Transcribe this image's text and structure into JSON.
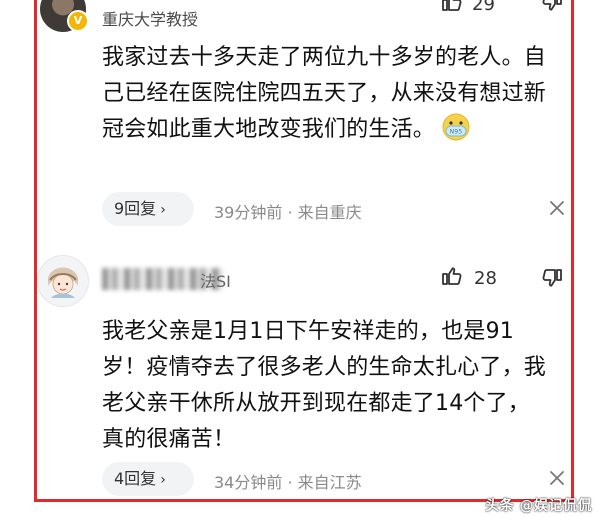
{
  "comments": [
    {
      "author": "重庆大学教授",
      "verified_badge": "V",
      "likes": "29",
      "text": "我家过去十多天走了两位九十多岁的老人。自己已经在医院住院四五天了，从来没有想过新冠会如此重大地改变我们的生活。",
      "emoji_label": "N95",
      "replies": "9回复",
      "time": "39分钟前 · 来自重庆"
    },
    {
      "author_tail": "法SI",
      "likes": "28",
      "text": "我老父亲是1月1日下午安祥走的，也是91岁！疫情夺去了很多老人的生命太扎心了，我老父亲干休所从放开到现在都走了14个了，真的很痛苦！",
      "replies": "4回复",
      "time": "34分钟前 · 来自江苏"
    }
  ],
  "watermark": "头条 @娱记侃侃",
  "colors": {
    "frame": "#e02b2b",
    "pill_bg": "#f2f3f5",
    "meta_text": "#8a8a8a",
    "badge": "#f2b705"
  },
  "icons": [
    "thumb-up-icon",
    "thumb-down-icon",
    "close-icon",
    "chevron-right-icon",
    "mask-emoji-icon"
  ]
}
